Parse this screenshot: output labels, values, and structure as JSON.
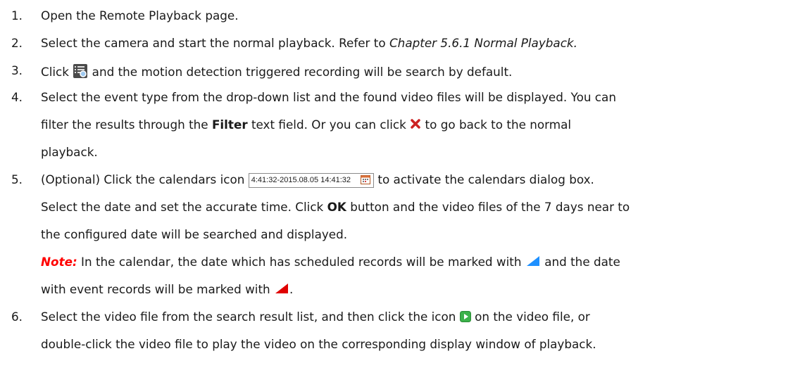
{
  "steps": [
    {
      "num": "1.",
      "text": "Open the Remote Playback page."
    },
    {
      "num": "2.",
      "text_a": "Select the camera and start the normal playback. Refer to ",
      "text_italic": "Chapter 5.6.1 Normal Playback."
    },
    {
      "num": "3.",
      "text_a": "Click ",
      "text_b": " and the motion detection triggered recording will be search by default.",
      "icon": "event-search-icon"
    },
    {
      "num": "4.",
      "line1": "Select the event type from the drop-down list and the found video files will be displayed. You can",
      "line2_a": "filter the results through the ",
      "line2_bold": "Filter",
      "line2_b": " text field. Or you can click ",
      "line2_c": " to go back to the normal",
      "line3": "playback.",
      "icon": "close-icon"
    },
    {
      "num": "5.",
      "line1_a": "(Optional) Click the calendars icon ",
      "timebox": "4:41:32-2015.08.05 14:41:32",
      "line1_b": " to activate the calendars dialog box.",
      "line2_a": "Select the date and set the accurate time. Click ",
      "line2_bold": "OK",
      "line2_b": " button and the video files of the 7 days near to",
      "line3": "the configured date will be searched and displayed.",
      "note_label": "Note:",
      "note_a": " In the calendar, the date which has scheduled records will be marked with ",
      "note_b": " and the date",
      "note2_a": "with event records will be marked with ",
      "note2_b": "."
    },
    {
      "num": "6.",
      "line1_a": "Select the video file from the search result list, and then click the icon ",
      "line1_b": " on the video file, or",
      "line2": "double-click the video file to play the video on the corresponding display window of playback.",
      "icon": "play-icon"
    }
  ],
  "colors": {
    "note": "#ff0000",
    "scheduled_marker": "#1e90ff",
    "event_marker": "#e00000",
    "close_icon": "#cc2222",
    "play_icon": "#2e9e3e"
  }
}
